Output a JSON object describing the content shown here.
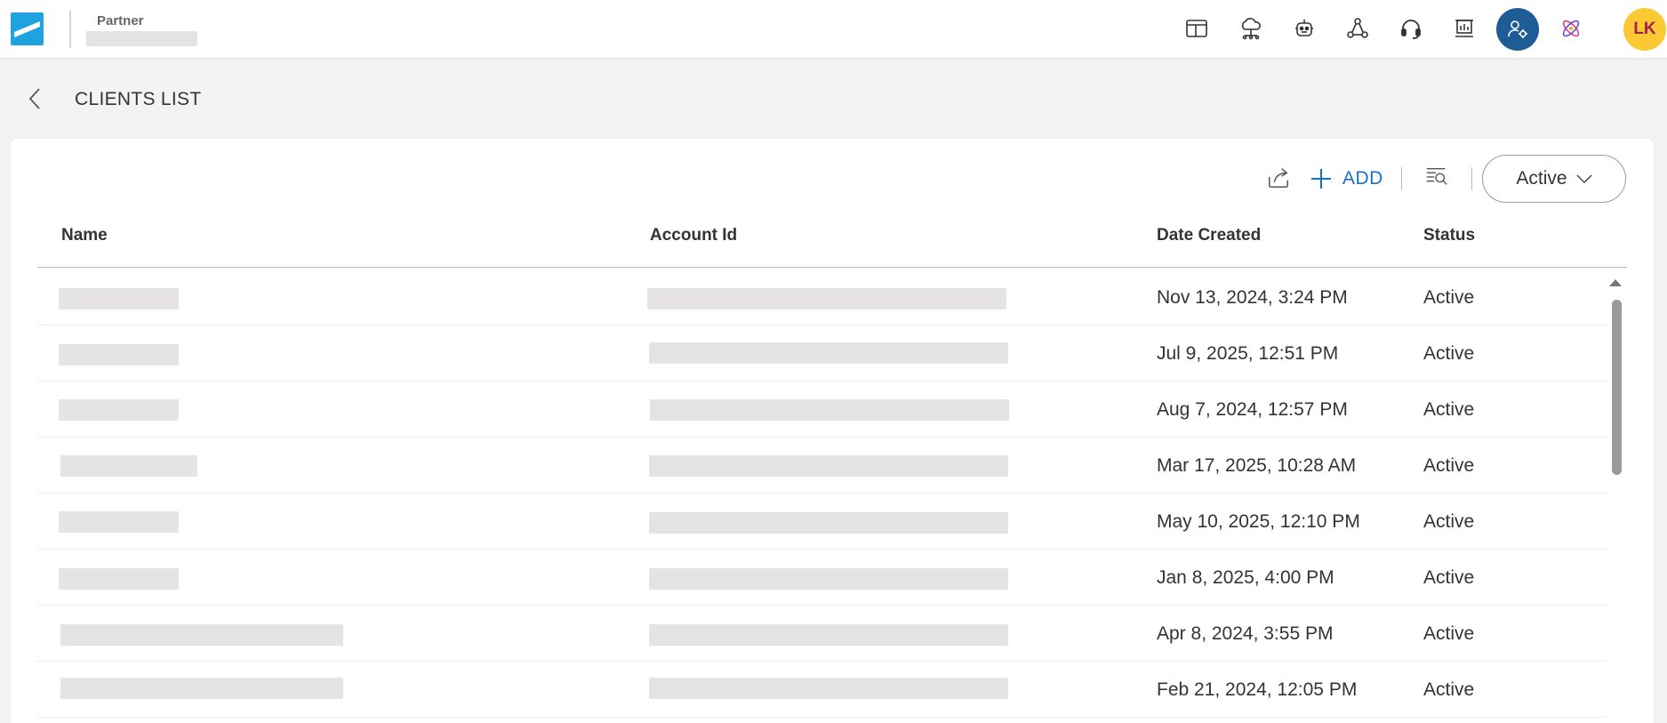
{
  "header": {
    "portal_label": "Partner",
    "partner_name": "",
    "avatar_initials": "LK",
    "icons": [
      "dashboard-icon",
      "cloud-network-icon",
      "bot-icon",
      "network-nodes-icon",
      "headset-support-icon",
      "reports-board-icon",
      "admin-settings-icon",
      "atom-icon"
    ]
  },
  "page": {
    "title": "CLIENTS LIST"
  },
  "toolbar": {
    "add_label": "ADD",
    "status_filter": "Active"
  },
  "table": {
    "columns": [
      "Name",
      "Account Id",
      "Date Created",
      "Status"
    ],
    "rows": [
      {
        "name": "",
        "account_id": "",
        "date_created": "Nov 13, 2024, 3:24 PM",
        "status": "Active"
      },
      {
        "name": "",
        "account_id": "",
        "date_created": "Jul 9, 2025, 12:51 PM",
        "status": "Active"
      },
      {
        "name": "",
        "account_id": "",
        "date_created": "Aug 7, 2024, 12:57 PM",
        "status": "Active"
      },
      {
        "name": "",
        "account_id": "",
        "date_created": "Mar 17, 2025, 10:28 AM",
        "status": "Active"
      },
      {
        "name": "",
        "account_id": "",
        "date_created": "May 10, 2025, 12:10 PM",
        "status": "Active"
      },
      {
        "name": "",
        "account_id": "",
        "date_created": "Jan 8, 2025, 4:00 PM",
        "status": "Active"
      },
      {
        "name": "",
        "account_id": "",
        "date_created": "Apr 8, 2024, 3:55 PM",
        "status": "Active"
      },
      {
        "name": "",
        "account_id": "",
        "date_created": "Feb 21, 2024, 12:05 PM",
        "status": "Active"
      }
    ]
  },
  "colors": {
    "brand_blue": "#1fa3e0",
    "accent_blue": "#1670c4",
    "admin_circle": "#1e5c96",
    "avatar_bg": "#fbc933",
    "avatar_text": "#a2204a"
  }
}
